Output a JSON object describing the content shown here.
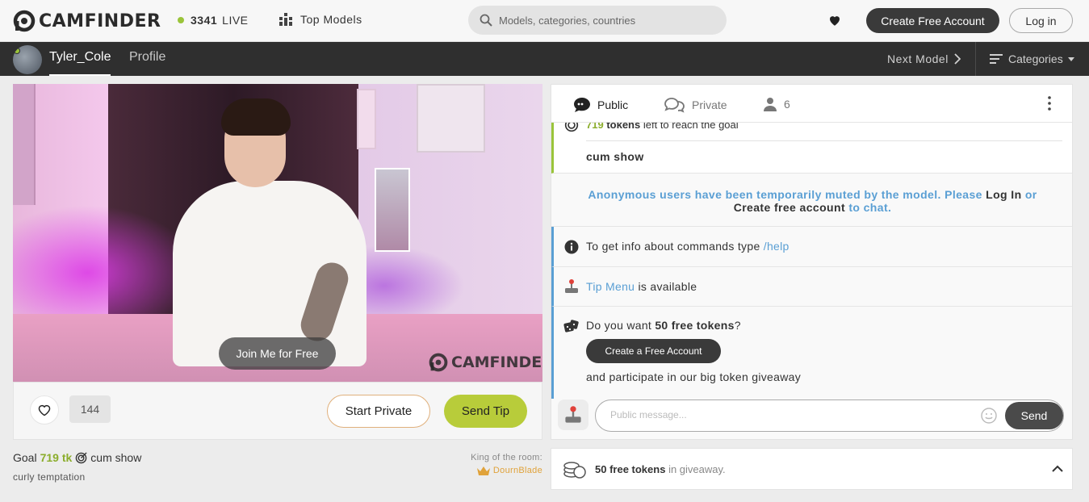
{
  "header": {
    "logo_text": "CAMFINDER",
    "live_count": "3341",
    "live_label": "LIVE",
    "top_models_label": "Top Models",
    "search_placeholder": "Models, categories, countries",
    "create_account_label": "Create Free Account",
    "login_label": "Log in"
  },
  "subnav": {
    "username": "Tyler_Cole",
    "profile_label": "Profile",
    "next_model_label": "Next Model",
    "categories_label": "Categories"
  },
  "video": {
    "join_label": "Join Me for Free",
    "watermark": "CAMFINDER"
  },
  "controls": {
    "like_count": "144",
    "start_private_label": "Start Private",
    "send_tip_label": "Send Tip"
  },
  "goal": {
    "prefix": "Goal",
    "tokens": "719 tk",
    "description": "cum show",
    "subject": "curly temptation",
    "king_label": "King of the room:",
    "king_name": "DournBlade"
  },
  "chat": {
    "tabs": {
      "public": "Public",
      "private": "Private",
      "users": "6"
    },
    "goal_msg": {
      "tokens": "719",
      "tokens_word": "tokens",
      "rest": "left to reach the goal",
      "goal_name": "cum show"
    },
    "muted_msg": {
      "part1": "Anonymous users have been temporarily muted by the model. Please",
      "login": "Log In",
      "or": "or",
      "create": "Create free account",
      "tail": "to chat."
    },
    "help_msg": {
      "text": "To get info about commands type",
      "command": "/help"
    },
    "tipmenu_msg": {
      "link": "Tip Menu",
      "text": "is available"
    },
    "free_msg": {
      "q_prefix": "Do you want",
      "q_bold": "50 free tokens",
      "q_suffix": "?",
      "button": "Create a Free Account",
      "answer": "and participate in our big token giveaway"
    },
    "composer": {
      "placeholder": "Public message...",
      "send_label": "Send"
    }
  },
  "giveaway": {
    "bold": "50 free tokens",
    "rest": "in giveaway."
  },
  "colors": {
    "accent_green": "#b8cc3a",
    "live_dot": "#9ac43a",
    "link_blue": "#5a9fd4",
    "dark_button": "#3a3a3a",
    "king_gold": "#e0a23a"
  }
}
